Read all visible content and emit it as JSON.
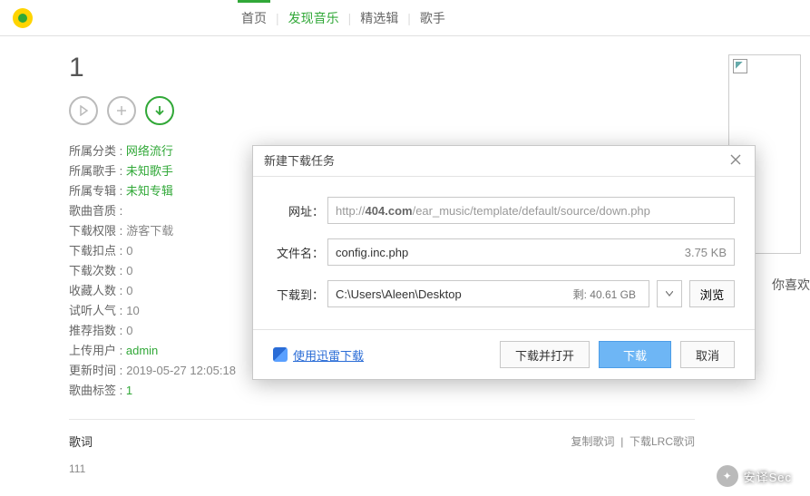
{
  "nav": {
    "home": "首页",
    "discover": "发现音乐",
    "selected": "精选辑",
    "singers": "歌手"
  },
  "title": "1",
  "meta": {
    "category_k": "所属分类 :",
    "category_v": "网络流行",
    "artist_k": "所属歌手 :",
    "artist_v": "未知歌手",
    "album_k": "所属专辑 :",
    "album_v": "未知专辑",
    "quality_k": "歌曲音质 :",
    "quality_v": "",
    "perm_k": "下载权限 :",
    "perm_v": "游客下载",
    "points_k": "下载扣点 :",
    "points_v": "0",
    "dcount_k": "下载次数 :",
    "dcount_v": "0",
    "fav_k": "收藏人数 :",
    "fav_v": "0",
    "listen_k": "试听人气 :",
    "listen_v": "10",
    "rec_k": "推荐指数 :",
    "rec_v": "0",
    "uploader_k": "上传用户 :",
    "uploader_v": "admin",
    "update_k": "更新时间 :",
    "update_v": "2019-05-27 12:05:18",
    "tags_k": "歌曲标签 :",
    "tags_v": "1"
  },
  "lyrics": {
    "heading": "歌词",
    "copy": "复制歌词",
    "download_lrc": "下载LRC歌词",
    "body": "111"
  },
  "like_hint": "你喜欢",
  "watermark": "安译Sec",
  "dialog": {
    "title": "新建下载任务",
    "url_label": "网址：",
    "url_prefix": "http://",
    "url_host": "404.com",
    "url_rest": "/ear_music/template/default/source/down.php",
    "file_label": "文件名：",
    "file_name": "config.inc.php",
    "file_size": "3.75 KB",
    "dest_label": "下载到：",
    "dest_path": "C:\\Users\\Aleen\\Desktop",
    "remaining": "剩: 40.61 GB",
    "browse": "浏览",
    "thunder_link": "使用迅雷下载",
    "btn_open": "下载并打开",
    "btn_download": "下载",
    "btn_cancel": "取消"
  }
}
